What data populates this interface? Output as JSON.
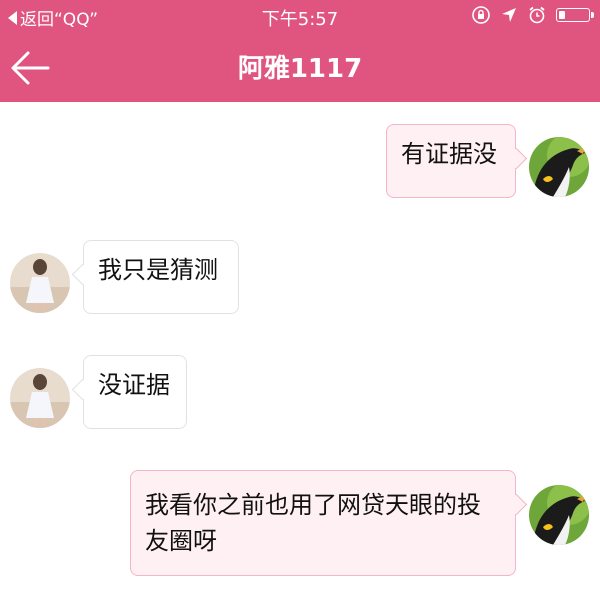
{
  "status_bar": {
    "back_to_app": "返回“QQ”",
    "time": "下午5:57"
  },
  "header": {
    "title": "阿雅1117",
    "background_color": "#e0557f"
  },
  "messages": [
    {
      "direction": "outgoing",
      "text": "有证据没"
    },
    {
      "direction": "incoming",
      "text": "我只是猜测"
    },
    {
      "direction": "incoming",
      "text": "没证据"
    },
    {
      "direction": "outgoing",
      "text": "我看你之前也用了网贷天眼的投友圈呀"
    }
  ],
  "icons": [
    "back-arrow-icon",
    "orientation-lock-icon",
    "location-arrow-icon",
    "alarm-icon",
    "battery-icon"
  ]
}
